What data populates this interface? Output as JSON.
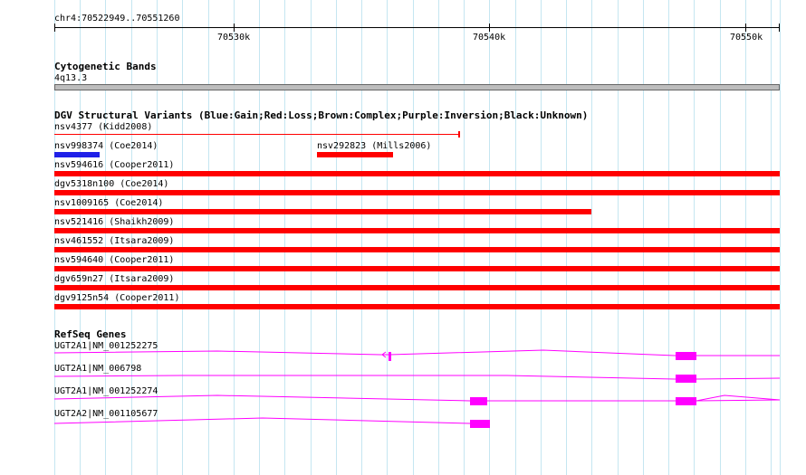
{
  "ruler": {
    "range_label": "chr4:70522949..70551260",
    "ticks": [
      "70530k",
      "70540k",
      "70550k"
    ]
  },
  "cytoband": {
    "title": "Cytogenetic Bands",
    "band": "4q13.3"
  },
  "dgv": {
    "title": "DGV Structural Variants (Blue:Gain;Red:Loss;Brown:Complex;Purple:Inversion;Black:Unknown)",
    "variants": [
      {
        "label": "nsv4377 (Kidd2008)",
        "type": "Loss",
        "color": "#ff0000"
      },
      {
        "label": "nsv998374 (Coe2014)",
        "type": "Gain",
        "color": "#1f20e8"
      },
      {
        "label": "nsv292823 (Mills2006)",
        "type": "Loss",
        "color": "#ff0000"
      },
      {
        "label": "nsv594616 (Cooper2011)",
        "type": "Loss",
        "color": "#ff0000"
      },
      {
        "label": "dgv5318n100 (Coe2014)",
        "type": "Loss",
        "color": "#ff0000"
      },
      {
        "label": "nsv1009165 (Coe2014)",
        "type": "Loss",
        "color": "#ff0000"
      },
      {
        "label": "nsv521416 (Shaikh2009)",
        "type": "Loss",
        "color": "#ff0000"
      },
      {
        "label": "nsv461552 (Itsara2009)",
        "type": "Loss",
        "color": "#ff0000"
      },
      {
        "label": "nsv594640 (Cooper2011)",
        "type": "Loss",
        "color": "#ff0000"
      },
      {
        "label": "dgv659n27 (Itsara2009)",
        "type": "Loss",
        "color": "#ff0000"
      },
      {
        "label": "dgv9125n54 (Cooper2011)",
        "type": "Loss",
        "color": "#ff0000"
      }
    ]
  },
  "refseq": {
    "title": "RefSeq Genes",
    "color": "#ff00ff",
    "genes": [
      {
        "label": "UGT2A1|NM_001252275"
      },
      {
        "label": "UGT2A1|NM_006798"
      },
      {
        "label": "UGT2A1|NM_001252274"
      },
      {
        "label": "UGT2A2|NM_001105677"
      }
    ]
  },
  "colors": {
    "grid": "#c5e6f1",
    "band": "#bdbdbd",
    "loss": "#ff0000",
    "gain": "#1f20e8",
    "gene": "#ff00ff"
  }
}
